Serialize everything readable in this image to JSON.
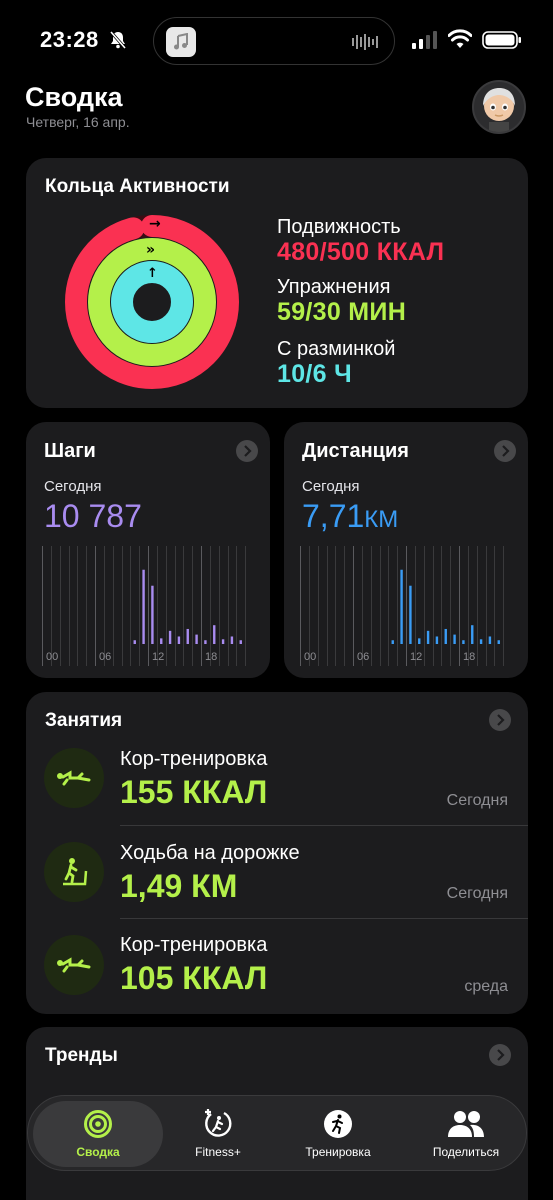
{
  "status_bar": {
    "time": "23:28"
  },
  "header": {
    "title": "Сводка",
    "date": "Четверг, 16 апр."
  },
  "rings": {
    "title": "Кольца Активности",
    "move": {
      "label": "Подвижность",
      "value": "480/500 ККАЛ",
      "color": "#fa3152",
      "progress": 0.96
    },
    "exercise": {
      "label": "Упражнения",
      "value": "59/30 МИН",
      "color": "#b4f04a",
      "progress": 1.97
    },
    "stand": {
      "label": "С разминкой",
      "value": "10/6 Ч",
      "color": "#5ee6e6",
      "progress": 1.67
    }
  },
  "steps": {
    "title": "Шаги",
    "subtitle": "Сегодня",
    "value": "10 787",
    "color": "#a98cf0",
    "x_labels": [
      "00",
      "06",
      "12",
      "18"
    ],
    "hourly": [
      0,
      0,
      0,
      0,
      0,
      0,
      0,
      0,
      0,
      0,
      0.04,
      0.79,
      0.62,
      0.06,
      0.14,
      0.08,
      0.16,
      0.1,
      0.04,
      0.2,
      0.05,
      0.08,
      0.04,
      0
    ]
  },
  "distance": {
    "title": "Дистанция",
    "subtitle": "Сегодня",
    "value": "7,71",
    "unit": "КМ",
    "color": "#3a9cf5",
    "x_labels": [
      "00",
      "06",
      "12",
      "18"
    ],
    "hourly": [
      0,
      0,
      0,
      0,
      0,
      0,
      0,
      0,
      0,
      0,
      0.04,
      0.79,
      0.62,
      0.06,
      0.14,
      0.08,
      0.16,
      0.1,
      0.04,
      0.2,
      0.05,
      0.08,
      0.04,
      0
    ]
  },
  "workouts": {
    "title": "Занятия",
    "items": [
      {
        "name": "Кор-тренировка",
        "value": "155 ККАЛ",
        "day": "Сегодня",
        "icon": "core-training-icon"
      },
      {
        "name": "Ходьба на дорожке",
        "value": "1,49 КМ",
        "day": "Сегодня",
        "icon": "treadmill-icon"
      },
      {
        "name": "Кор-тренировка",
        "value": "105 ККАЛ",
        "day": "среда",
        "icon": "core-training-icon"
      }
    ]
  },
  "trends": {
    "title": "Тренды"
  },
  "tabbar": {
    "tabs": [
      {
        "label": "Сводка",
        "icon": "summary-rings-icon",
        "active": true
      },
      {
        "label": "Fitness+",
        "icon": "fitness-plus-icon",
        "active": false
      },
      {
        "label": "Тренировка",
        "icon": "workout-runner-icon",
        "active": false
      },
      {
        "label": "Поделиться",
        "icon": "sharing-people-icon",
        "active": false
      }
    ]
  },
  "colors": {
    "accent": "#b4f04a",
    "card": "#1c1c1e",
    "secondary_text": "#8e8e93"
  }
}
